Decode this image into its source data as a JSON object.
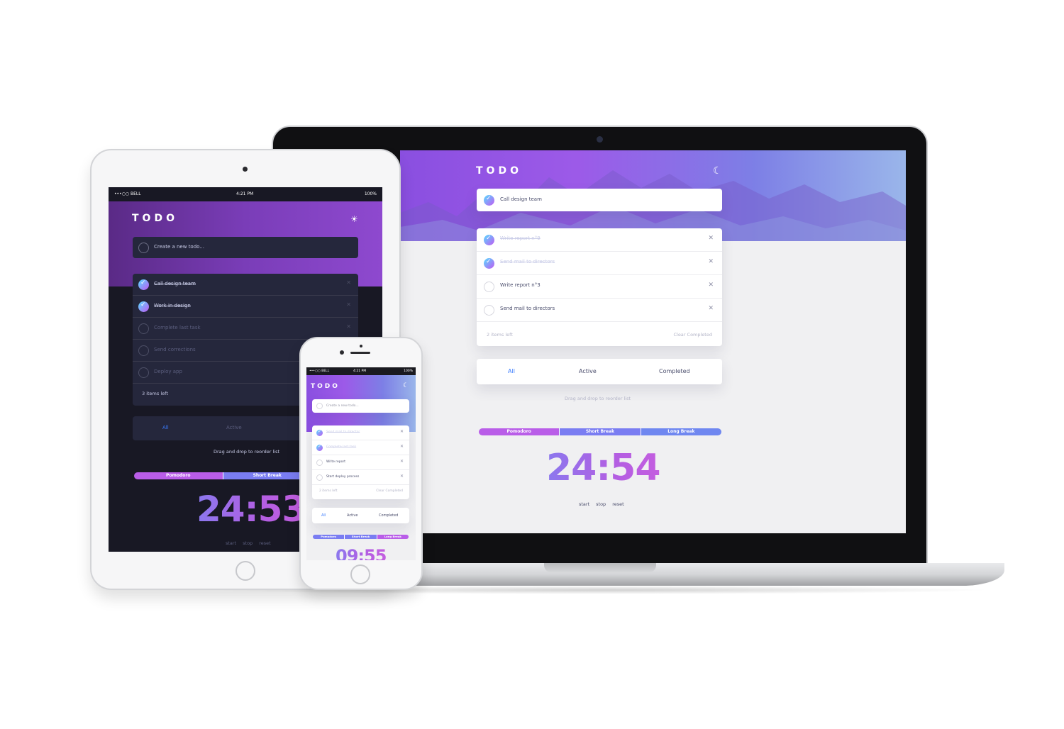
{
  "laptop": {
    "title": "TODO",
    "theme_icon": "moon-icon",
    "new_todo_text": "Call design team",
    "todos": [
      {
        "text": "Write report n°9",
        "completed": true
      },
      {
        "text": "Send mail to directors",
        "completed": true
      },
      {
        "text": "Write report n°3",
        "completed": false
      },
      {
        "text": "Send mail to directors",
        "completed": false
      }
    ],
    "items_left": "2 items left",
    "clear_completed": "Clear Completed",
    "filters": {
      "all": "All",
      "active": "Active",
      "completed": "Completed"
    },
    "hint": "Drag and drop to reorder list",
    "modes": {
      "pomodoro": "Pomodoro",
      "short_break": "Short Break",
      "long_break": "Long Break"
    },
    "timer": "24:54",
    "controls": {
      "start": "start",
      "stop": "stop",
      "reset": "reset"
    }
  },
  "tablet": {
    "status": {
      "carrier": "•••○○ BELL",
      "time": "4:21 PM",
      "battery": "100%"
    },
    "title": "TODO",
    "theme_icon": "sun-icon",
    "new_todo_placeholder": "Create a new todo...",
    "todos": [
      {
        "text": "Call design team",
        "completed": true
      },
      {
        "text": "Work in design",
        "completed": true
      },
      {
        "text": "Complete last task",
        "completed": false
      },
      {
        "text": "Send corrections",
        "completed": false
      },
      {
        "text": "Deploy app",
        "completed": false
      }
    ],
    "items_left": "3 items left",
    "filters": {
      "all": "All",
      "active": "Active"
    },
    "hint": "Drag and drop to reorder list",
    "modes": {
      "pomodoro": "Pomodoro",
      "short_break": "Short Break"
    },
    "timer": "24:53",
    "controls": {
      "start": "start",
      "stop": "stop",
      "reset": "reset"
    }
  },
  "phone": {
    "status": {
      "carrier": "•••○○ BELL",
      "time": "4:21 PM",
      "battery": "100%"
    },
    "title": "TODO",
    "theme_icon": "moon-icon",
    "new_todo_placeholder": "Create a new todo...",
    "todos": [
      {
        "text": "Send mail to director",
        "completed": true
      },
      {
        "text": "Complete last task",
        "completed": true
      },
      {
        "text": "Write report",
        "completed": false
      },
      {
        "text": "Start deploy process",
        "completed": false
      }
    ],
    "items_left": "2 items left",
    "clear_completed": "Clear Completed",
    "filters": {
      "all": "All",
      "active": "Active",
      "completed": "Completed"
    },
    "modes": {
      "pomodoro": "Pomodoro",
      "short_break": "Short Break",
      "long_break": "Long Break"
    },
    "timer": "09:55"
  },
  "colors": {
    "accent": "#3a7bfd",
    "purple": "#b95de8",
    "dark_bg": "#181824",
    "light_bg": "#f0f0f2"
  }
}
